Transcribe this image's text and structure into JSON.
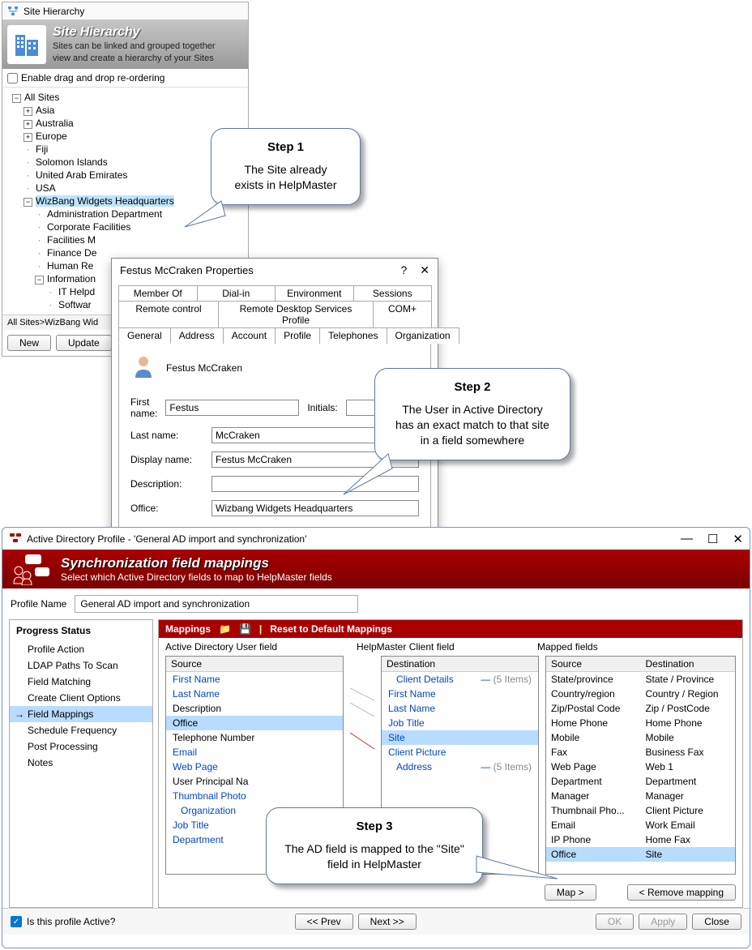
{
  "site_hierarchy": {
    "title": "Site Hierarchy",
    "header_title": "Site Hierarchy",
    "header_sub1": "Sites can be linked and grouped together",
    "header_sub2": "view and create a hierarchy of your Sites",
    "enable_drag": "Enable drag and drop re-ordering",
    "root": "All Sites",
    "nodes": {
      "asia": "Asia",
      "australia": "Australia",
      "europe": "Europe",
      "fiji": "Fiji",
      "solomon": "Solomon Islands",
      "uae": "United Arab Emirates",
      "usa": "USA",
      "wizbang": "WizBang Widgets Headquarters",
      "admin": "Administration Department",
      "corp": "Corporate Facilities",
      "facilities": "Facilities M",
      "finance": "Finance De",
      "hr": "Human Re",
      "info": "Information",
      "it": "IT Helpd",
      "software": "Softwar"
    },
    "breadcrumb": "All Sites>WizBang Wid",
    "btn_new": "New",
    "btn_update": "Update"
  },
  "ad_props": {
    "title": "Festus McCraken Properties",
    "tabs_row1": {
      "memberof": "Member Of",
      "dialin": "Dial-in",
      "env": "Environment",
      "sessions": "Sessions"
    },
    "tabs_row2": {
      "remote": "Remote control",
      "rds": "Remote Desktop Services Profile",
      "com": "COM+"
    },
    "tabs_row3": {
      "general": "General",
      "address": "Address",
      "account": "Account",
      "profile": "Profile",
      "tel": "Telephones",
      "org": "Organization"
    },
    "display_name_heading": "Festus McCraken",
    "labels": {
      "firstname": "First name:",
      "initials": "Initials:",
      "lastname": "Last name:",
      "display": "Display name:",
      "desc": "Description:",
      "office": "Office:"
    },
    "values": {
      "firstname": "Festus",
      "initials": "",
      "lastname": "McCraken",
      "display": "Festus McCraken",
      "desc": "",
      "office": "Wizbang Widgets Headquarters"
    }
  },
  "callouts": {
    "step1_title": "Step 1",
    "step1_body": "The Site already exists in HelpMaster",
    "step2_title": "Step 2",
    "step2_body": "The User in Active Directory has an exact match to that site in a field somewhere",
    "step3_title": "Step 3",
    "step3_body": "The AD field is mapped to the \"Site\" field in HelpMaster"
  },
  "sync": {
    "title": "Active Directory Profile - 'General AD import and synchronization'",
    "header_title": "Synchronization field mappings",
    "header_sub": "Select which Active Directory fields to map to HelpMaster fields",
    "profile_label": "Profile Name",
    "profile_value": "General AD import and synchronization",
    "sidebar_title": "Progress Status",
    "sidebar_items": [
      "Profile Action",
      "LDAP Paths To Scan",
      "Field Matching",
      "Create Client Options",
      "Field Mappings",
      "Schedule Frequency",
      "Post Processing",
      "Notes"
    ],
    "mappings_label": "Mappings",
    "reset_label": "Reset to Default Mappings",
    "col1_header": "Active Directory User field",
    "col2_header": "HelpMaster Client field",
    "col3_header": "Mapped fields",
    "source_h": "Source",
    "dest_h": "Destination",
    "ad_fields": [
      "First Name",
      "Last Name",
      "Description",
      "Office",
      "Telephone Number",
      "Email",
      "Web Page",
      "User Principal Na",
      "Thumbnail Photo"
    ],
    "ad_group": "Organization",
    "ad_more": [
      "Job Title",
      "Department"
    ],
    "hm_group1": "Client Details",
    "hm_group1_count": "(5 Items)",
    "hm_fields": [
      "First Name",
      "Last Name",
      "Job Title",
      "Site",
      "Client Picture"
    ],
    "hm_group2": "Address",
    "hm_group2_count": "(5 Items)",
    "mapped": [
      {
        "src": "State/province",
        "dst": "State / Province"
      },
      {
        "src": "Country/region",
        "dst": "Country / Region"
      },
      {
        "src": "Zip/Postal Code",
        "dst": "Zip / PostCode"
      },
      {
        "src": "Home Phone",
        "dst": "Home Phone"
      },
      {
        "src": "Mobile",
        "dst": "Mobile"
      },
      {
        "src": "Fax",
        "dst": "Business Fax"
      },
      {
        "src": "Web Page",
        "dst": "Web 1"
      },
      {
        "src": "Department",
        "dst": "Department"
      },
      {
        "src": "Manager",
        "dst": "Manager"
      },
      {
        "src": "Thumbnail Pho...",
        "dst": "Client Picture"
      },
      {
        "src": "Email",
        "dst": "Work Email"
      },
      {
        "src": "IP Phone",
        "dst": "Home Fax"
      },
      {
        "src": "Office",
        "dst": "Site"
      }
    ],
    "btn_map": "Map >",
    "btn_remove": "< Remove mapping",
    "footer_active": "Is this profile Active?",
    "btn_prev": "<< Prev",
    "btn_next": "Next >>",
    "btn_ok": "OK",
    "btn_apply": "Apply",
    "btn_close": "Close"
  }
}
